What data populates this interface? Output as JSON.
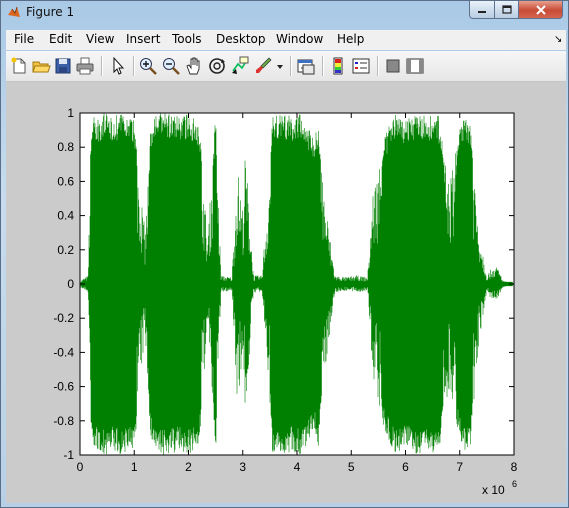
{
  "window": {
    "title": "Figure 1"
  },
  "menu": [
    "File",
    "Edit",
    "View",
    "Insert",
    "Tools",
    "Desktop",
    "Window",
    "Help"
  ],
  "menu_overflow": "↘",
  "toolbar": {
    "icons": [
      "new-figure-icon",
      "open-file-icon",
      "save-icon",
      "print-icon",
      "select-arrow-icon",
      "zoom-in-icon",
      "zoom-out-icon",
      "pan-hand-icon",
      "rotate-3d-icon",
      "data-cursor-icon",
      "brush-icon",
      "brush-dropdown-icon",
      "link-plot-icon",
      "colorbar-icon",
      "legend-icon",
      "hide-plot-tools-icon",
      "show-plot-tools-icon"
    ]
  },
  "colors": {
    "signal": "#008000",
    "figure_bg": "#cbcbcb",
    "axes_bg": "#ffffff"
  },
  "chart_data": {
    "type": "line",
    "title": "",
    "xlabel": "",
    "ylabel": "",
    "x_exponent_label": "x 10",
    "x_exponent_power": "6",
    "xlim": [
      0,
      8
    ],
    "ylim": [
      -1,
      1
    ],
    "x_ticks": [
      "0",
      "1",
      "2",
      "3",
      "4",
      "5",
      "6",
      "7",
      "8"
    ],
    "y_ticks": [
      "1",
      "0.8",
      "0.6",
      "0.4",
      "0.2",
      "0",
      "-0.2",
      "-0.4",
      "-0.6",
      "-0.8",
      "-1"
    ],
    "grid": false,
    "series": [
      {
        "color": "#008000",
        "envelope_description": "audio waveform amplitude envelope, x in units of 10^6 samples",
        "x": [
          0.0,
          0.15,
          0.2,
          0.25,
          0.3,
          0.45,
          0.6,
          0.8,
          1.0,
          1.2,
          1.3,
          1.4,
          1.6,
          1.8,
          2.0,
          2.2,
          2.35,
          2.5,
          2.6,
          2.8,
          2.9,
          3.0,
          3.05,
          3.2,
          3.35,
          3.45,
          3.55,
          3.7,
          3.9,
          4.1,
          4.3,
          4.4,
          4.5,
          4.7,
          4.9,
          5.1,
          5.3,
          5.4,
          5.6,
          5.8,
          6.0,
          6.2,
          6.4,
          6.6,
          6.8,
          7.0,
          7.1,
          7.2,
          7.35,
          7.5,
          7.6,
          7.7,
          7.8,
          8.0
        ],
        "amplitude": [
          0.02,
          0.05,
          0.9,
          1.0,
          0.97,
          1.0,
          0.98,
          1.0,
          0.96,
          0.3,
          0.9,
          1.0,
          1.0,
          0.98,
          1.0,
          0.95,
          0.25,
          1.0,
          0.05,
          0.04,
          0.7,
          0.45,
          0.8,
          0.05,
          0.05,
          0.45,
          1.0,
          1.0,
          0.98,
          1.0,
          0.85,
          0.95,
          0.55,
          0.05,
          0.04,
          0.05,
          0.04,
          0.55,
          0.85,
          1.0,
          0.96,
          1.0,
          0.98,
          1.0,
          0.6,
          0.9,
          1.0,
          0.95,
          0.35,
          0.05,
          0.1,
          0.1,
          0.02,
          0.0
        ]
      }
    ]
  }
}
